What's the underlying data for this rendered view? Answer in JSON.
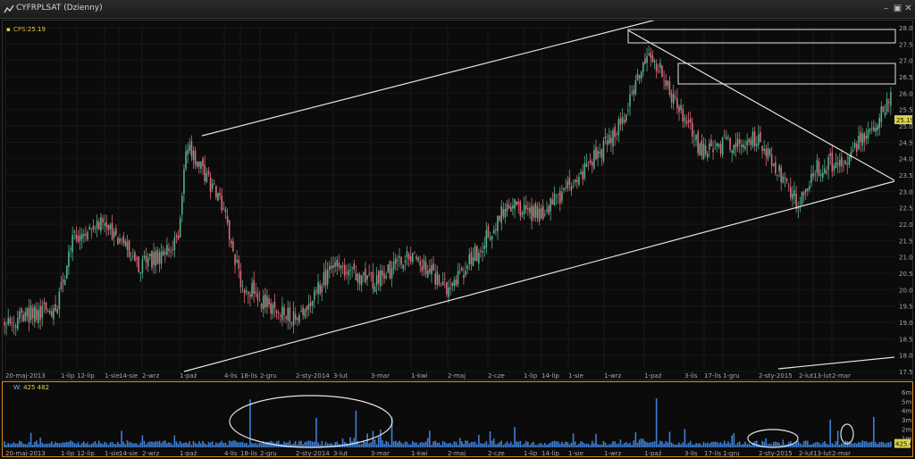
{
  "window": {
    "title": "CYFRPLSAT (Dzienny)",
    "minimize_icon": "minimize-icon",
    "restore_icon": "restore-icon",
    "close_icon": "close-icon"
  },
  "colors": {
    "background": "#0b0b0b",
    "up_candle": "#4fb08a",
    "down_candle": "#d96a78",
    "trendline": "#e4e4e4",
    "volume_bar": "#3f7fd6",
    "price_legend": "#d7d34a",
    "panel_border": "#d98a24"
  },
  "price_panel": {
    "legend_name": "CPS:",
    "legend_value": "25.19",
    "last_price_label": "25.19"
  },
  "volume_panel": {
    "legend_name": "W:",
    "legend_value": "425 482",
    "last_volume_label": "425.48"
  },
  "chart_data": [
    {
      "type": "candlestick",
      "title": "CYFRPLSAT (Dzienny)",
      "ylim": [
        17.5,
        28.0
      ],
      "y_ticks": [
        "17.5",
        "18.0",
        "18.5",
        "19.0",
        "19.5",
        "20.0",
        "20.5",
        "21.0",
        "21.5",
        "22.0",
        "22.5",
        "23.0",
        "23.5",
        "24.0",
        "24.5",
        "25.0",
        "25.5",
        "26.0",
        "26.5",
        "27.0",
        "27.5",
        "28.0"
      ],
      "x_tick_labels": [
        "20-maj-2013",
        "1-lip",
        "12-lip",
        "1-sie",
        "14-sie",
        "2-wrz",
        "1-paź",
        "4-lis",
        "18-lis",
        "2-gru",
        "2-sty-2014",
        "3-lut",
        "3-mar",
        "1-kwi",
        "2-maj",
        "2-cze",
        "1-lip",
        "14-lip",
        "1-sie",
        "1-wrz",
        "1-paź",
        "3-lis",
        "17-lis",
        "1-gru",
        "2-sty-2015",
        "2-lut",
        "13-lut",
        "2-mar"
      ],
      "close_key_points": [
        [
          "20-maj-2013",
          19.0
        ],
        [
          "1-lip",
          19.5
        ],
        [
          "12-lip",
          21.5
        ],
        [
          "1-sie",
          22.0
        ],
        [
          "14-sie",
          21.6
        ],
        [
          "2-wrz",
          20.7
        ],
        [
          "1-paź",
          21.4
        ],
        [
          "4-paź",
          24.5
        ],
        [
          "4-lis",
          22.6
        ],
        [
          "18-lis",
          20.2
        ],
        [
          "2-gru",
          19.7
        ],
        [
          "2-sty-2014",
          19.0
        ],
        [
          "3-lut",
          20.8
        ],
        [
          "3-mar",
          20.2
        ],
        [
          "1-kwi",
          21.0
        ],
        [
          "2-maj",
          20.0
        ],
        [
          "2-cze",
          21.8
        ],
        [
          "1-lip",
          22.6
        ],
        [
          "14-lip",
          22.3
        ],
        [
          "1-sie",
          23.5
        ],
        [
          "1-wrz",
          25.2
        ],
        [
          "1-paź",
          27.3
        ],
        [
          "17-paź",
          26.8
        ],
        [
          "3-lis",
          25.6
        ],
        [
          "17-lis",
          24.3
        ],
        [
          "1-gru",
          24.6
        ],
        [
          "2-sty-2015",
          22.6
        ],
        [
          "2-lut",
          23.7
        ],
        [
          "13-lut",
          24.0
        ],
        [
          "2-mar",
          25.8
        ],
        [
          "last",
          25.19
        ]
      ],
      "trendlines": "ascending channel with two parallel lines, descending line from the October 2014 high, support rectangles near 27.5–28.0 and 26.2–26.8",
      "last_value": 25.19
    },
    {
      "type": "bar",
      "title": "W",
      "ylim": [
        0,
        6000000
      ],
      "y_tick_labels": [
        "1m",
        "2m",
        "3m",
        "4m",
        "5m",
        "6m"
      ],
      "last_value": 425482
    }
  ]
}
